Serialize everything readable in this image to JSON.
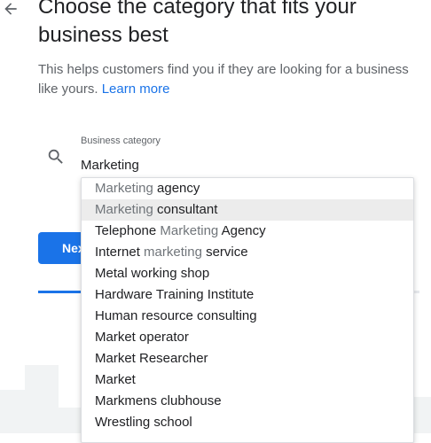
{
  "header": {
    "title": "Choose the category that fits your business best",
    "description": "This helps customers find you if they are looking for a business like yours.",
    "learn_more": "Learn more"
  },
  "field": {
    "label": "Business category",
    "value": "Marketing"
  },
  "next_button_label": "Next",
  "progress": {
    "fraction": 0.3
  },
  "suggestions": [
    {
      "segments": [
        {
          "text": "Marketing",
          "match": true
        },
        {
          "text": " agency",
          "match": false
        }
      ]
    },
    {
      "segments": [
        {
          "text": "Marketing",
          "match": true
        },
        {
          "text": " consultant",
          "match": false
        }
      ],
      "highlighted": true
    },
    {
      "segments": [
        {
          "text": "Telephone ",
          "match": false
        },
        {
          "text": "Marketing",
          "match": true
        },
        {
          "text": " Agency",
          "match": false
        }
      ]
    },
    {
      "segments": [
        {
          "text": "Internet ",
          "match": false
        },
        {
          "text": "marketing",
          "match": true
        },
        {
          "text": " service",
          "match": false
        }
      ]
    },
    {
      "segments": [
        {
          "text": "Metal working shop",
          "match": false
        }
      ]
    },
    {
      "segments": [
        {
          "text": "Hardware Training Institute",
          "match": false
        }
      ]
    },
    {
      "segments": [
        {
          "text": "Human resource consulting",
          "match": false
        }
      ]
    },
    {
      "segments": [
        {
          "text": "Market operator",
          "match": false
        }
      ]
    },
    {
      "segments": [
        {
          "text": "Market Researcher",
          "match": false
        }
      ]
    },
    {
      "segments": [
        {
          "text": "Market",
          "match": false
        }
      ]
    },
    {
      "segments": [
        {
          "text": "Markmens clubhouse",
          "match": false
        }
      ]
    },
    {
      "segments": [
        {
          "text": "Wrestling school",
          "match": false
        }
      ]
    }
  ],
  "colors": {
    "accent": "#1a73e8",
    "match_text": "#70757a",
    "highlight_row": "#ececec"
  },
  "icons": {
    "back": "arrow-back-icon",
    "search": "search-icon"
  }
}
